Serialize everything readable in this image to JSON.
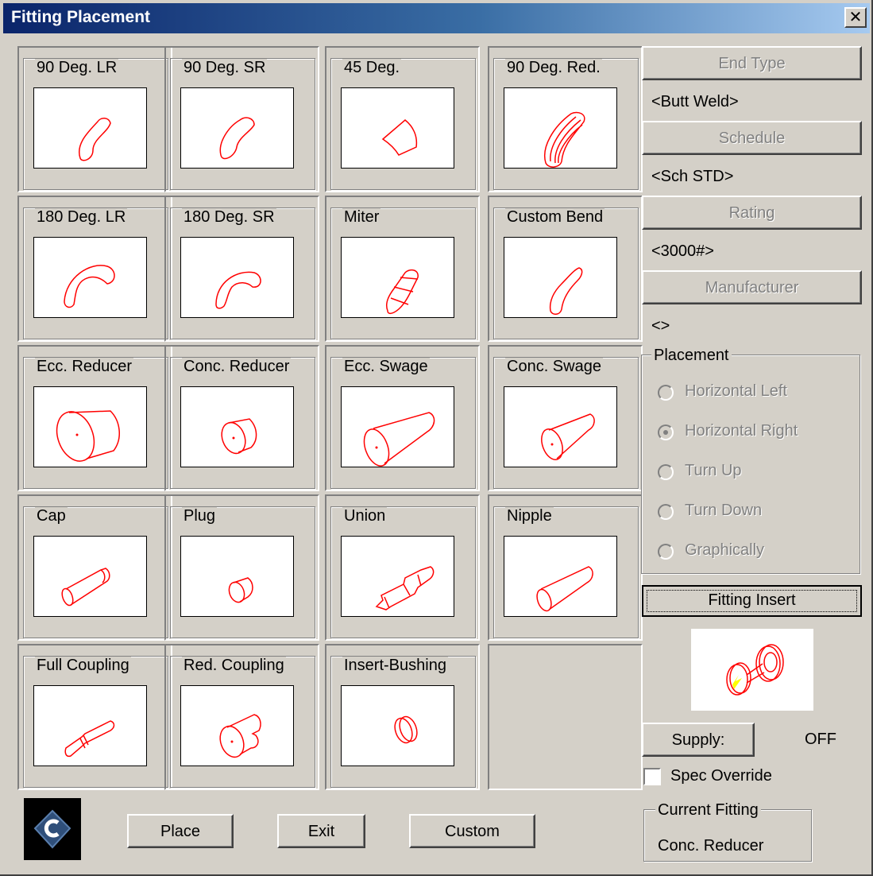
{
  "window": {
    "title": "Fitting Placement",
    "close_glyph": "✕"
  },
  "fittings": [
    {
      "label": "90 Deg. LR",
      "icon": "elbow-90-lr-icon"
    },
    {
      "label": "90 Deg. SR",
      "icon": "elbow-90-sr-icon"
    },
    {
      "label": "45 Deg.",
      "icon": "elbow-45-icon"
    },
    {
      "label": "90 Deg. Red.",
      "icon": "elbow-90-reducing-icon"
    },
    {
      "label": "180 Deg. LR",
      "icon": "return-180-lr-icon"
    },
    {
      "label": "180 Deg. SR",
      "icon": "return-180-sr-icon"
    },
    {
      "label": "Miter",
      "icon": "miter-elbow-icon"
    },
    {
      "label": "Custom Bend",
      "icon": "custom-bend-icon"
    },
    {
      "label": "Ecc. Reducer",
      "icon": "ecc-reducer-icon"
    },
    {
      "label": "Conc. Reducer",
      "icon": "conc-reducer-icon"
    },
    {
      "label": "Ecc. Swage",
      "icon": "ecc-swage-icon"
    },
    {
      "label": "Conc. Swage",
      "icon": "conc-swage-icon"
    },
    {
      "label": "Cap",
      "icon": "cap-icon"
    },
    {
      "label": "Plug",
      "icon": "plug-icon"
    },
    {
      "label": "Union",
      "icon": "union-icon"
    },
    {
      "label": "Nipple",
      "icon": "nipple-icon"
    },
    {
      "label": "Full Coupling",
      "icon": "full-coupling-icon"
    },
    {
      "label": "Red. Coupling",
      "icon": "reducing-coupling-icon"
    },
    {
      "label": "Insert-Bushing",
      "icon": "insert-bushing-icon"
    }
  ],
  "side": {
    "end_type_label": "End Type",
    "end_type_value": "<Butt Weld>",
    "schedule_label": "Schedule",
    "schedule_value": "<Sch STD>",
    "rating_label": "Rating",
    "rating_value": "<3000#>",
    "manufacturer_label": "Manufacturer",
    "manufacturer_value": "<>"
  },
  "placement": {
    "title": "Placement",
    "options": [
      {
        "label": "Horizontal Left",
        "selected": false
      },
      {
        "label": "Horizontal Right",
        "selected": true
      },
      {
        "label": "Turn Up",
        "selected": false
      },
      {
        "label": "Turn Down",
        "selected": false
      },
      {
        "label": "Graphically",
        "selected": false
      }
    ]
  },
  "fitting_insert_label": "Fitting Insert",
  "supply": {
    "label": "Supply:",
    "value": "OFF"
  },
  "spec_override": {
    "label": "Spec Override",
    "checked": false
  },
  "current_fitting": {
    "title": "Current Fitting",
    "value": "Conc. Reducer"
  },
  "footer": {
    "place_label": "Place",
    "exit_label": "Exit",
    "custom_label": "Custom"
  },
  "colors": {
    "title_start": "#0a246a",
    "title_end": "#a6caf0",
    "drawing": "#ff0000",
    "face": "#d4d0c8"
  }
}
